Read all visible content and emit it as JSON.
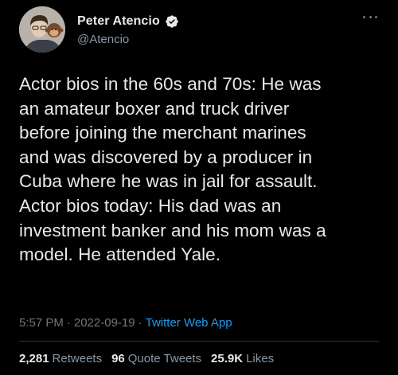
{
  "author": {
    "display_name": "Peter Atencio",
    "handle": "@Atencio",
    "verified": true,
    "verified_color": "#1d9bf0"
  },
  "tweet": {
    "text": "Actor bios in the 60s and 70s: He was\nan amateur boxer and truck driver\nbefore joining the merchant marines\nand was discovered by a producer in\nCuba where he was in jail for assault.\nActor bios today: His dad was an\ninvestment banker and his mom was a\nmodel. He attended Yale.",
    "time": "5:57 PM",
    "separator": "·",
    "date": "2022-09-19",
    "source": "Twitter Web App"
  },
  "stats": {
    "retweets_count": "2,281",
    "retweets_label": "Retweets",
    "quotes_count": "96",
    "quotes_label": "Quote Tweets",
    "likes_count": "25.9K",
    "likes_label": "Likes"
  },
  "icons": {
    "more": "more-options-icon",
    "verified": "verified-badge-icon"
  },
  "colors": {
    "background": "#000000",
    "text": "#e7e9ea",
    "muted": "#71767b",
    "link": "#1d9bf0"
  }
}
